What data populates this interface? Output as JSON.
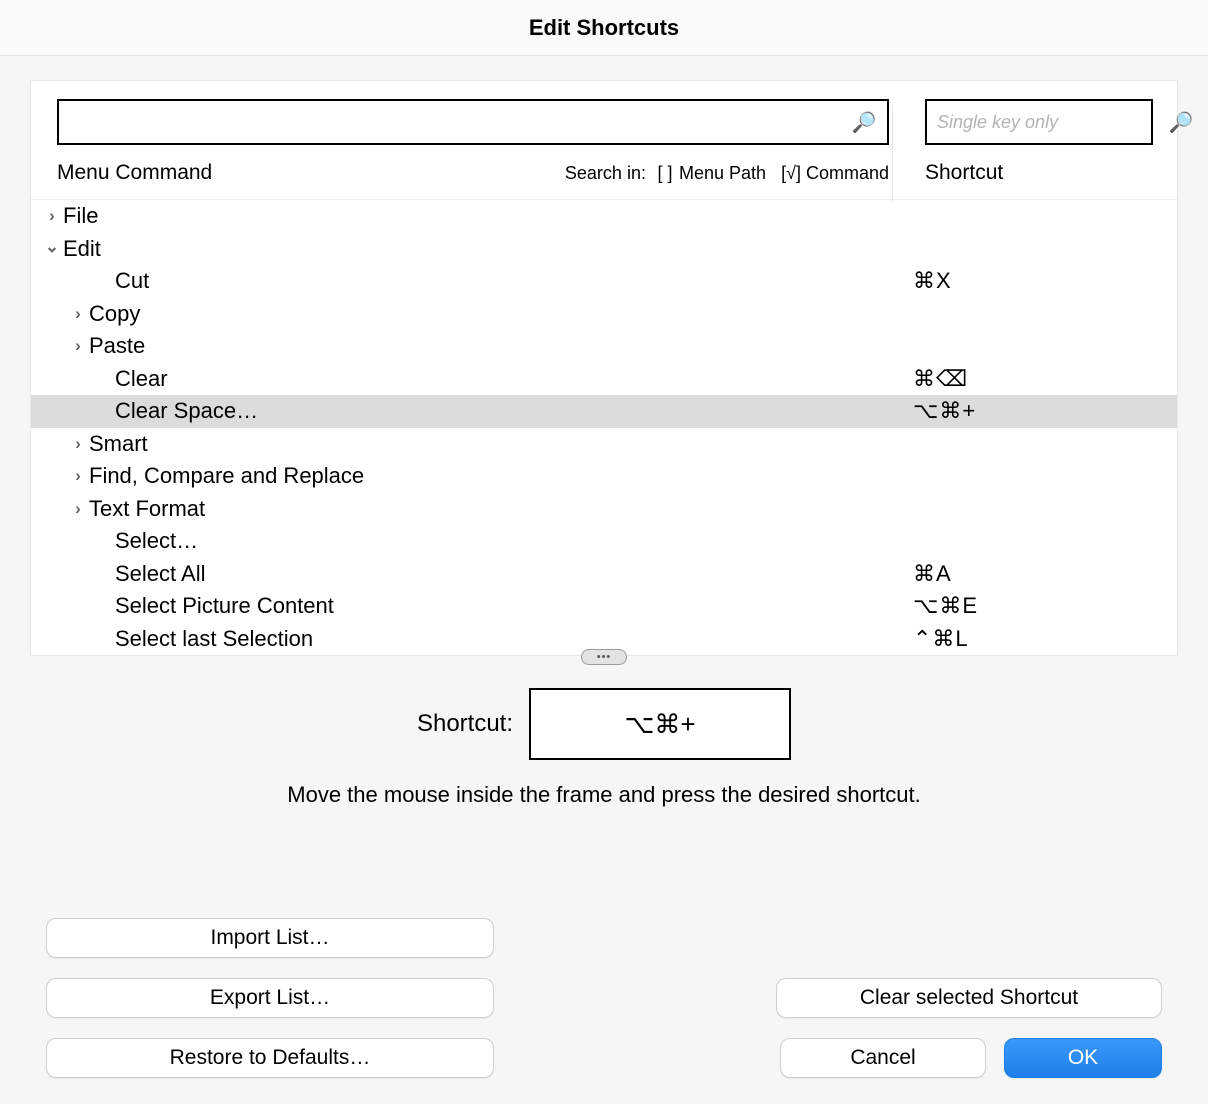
{
  "title": "Edit Shortcuts",
  "search": {
    "menu_value": "",
    "shortcut_placeholder": "Single key only",
    "shortcut_value": ""
  },
  "headers": {
    "menu_command": "Menu Command",
    "shortcut": "Shortcut",
    "search_in_label": "Search in:",
    "menu_path_label": "Menu Path",
    "command_label": "Command",
    "menu_path_checked": false,
    "command_checked": true
  },
  "tree": [
    {
      "indent": 0,
      "arrow": "right",
      "name": "File",
      "key": "",
      "selected": false
    },
    {
      "indent": 0,
      "arrow": "down",
      "name": "Edit",
      "key": "",
      "selected": false
    },
    {
      "indent": 2,
      "arrow": "",
      "name": "Cut",
      "key": "⌘X",
      "selected": false
    },
    {
      "indent": 1,
      "arrow": "right",
      "name": "Copy",
      "key": "",
      "selected": false
    },
    {
      "indent": 1,
      "arrow": "right",
      "name": "Paste",
      "key": "",
      "selected": false
    },
    {
      "indent": 2,
      "arrow": "",
      "name": "Clear",
      "key": "⌘⌫",
      "selected": false
    },
    {
      "indent": 2,
      "arrow": "",
      "name": "Clear Space…",
      "key": "⌥⌘+",
      "selected": true
    },
    {
      "indent": 1,
      "arrow": "right",
      "name": "Smart",
      "key": "",
      "selected": false
    },
    {
      "indent": 1,
      "arrow": "right",
      "name": "Find, Compare and Replace",
      "key": "",
      "selected": false
    },
    {
      "indent": 1,
      "arrow": "right",
      "name": "Text Format",
      "key": "",
      "selected": false
    },
    {
      "indent": 2,
      "arrow": "",
      "name": "Select…",
      "key": "",
      "selected": false
    },
    {
      "indent": 2,
      "arrow": "",
      "name": "Select All",
      "key": "⌘A",
      "selected": false
    },
    {
      "indent": 2,
      "arrow": "",
      "name": "Select Picture Content",
      "key": "⌥⌘E",
      "selected": false
    },
    {
      "indent": 2,
      "arrow": "",
      "name": "Select last Selection",
      "key": "⌃⌘L",
      "selected": false
    }
  ],
  "editor": {
    "label": "Shortcut:",
    "value": "⌥⌘+",
    "hint": "Move the mouse inside the frame and press the desired shortcut."
  },
  "buttons": {
    "import": "Import List…",
    "export": "Export List…",
    "restore": "Restore to Defaults…",
    "clear": "Clear selected Shortcut",
    "cancel": "Cancel",
    "ok": "OK"
  }
}
